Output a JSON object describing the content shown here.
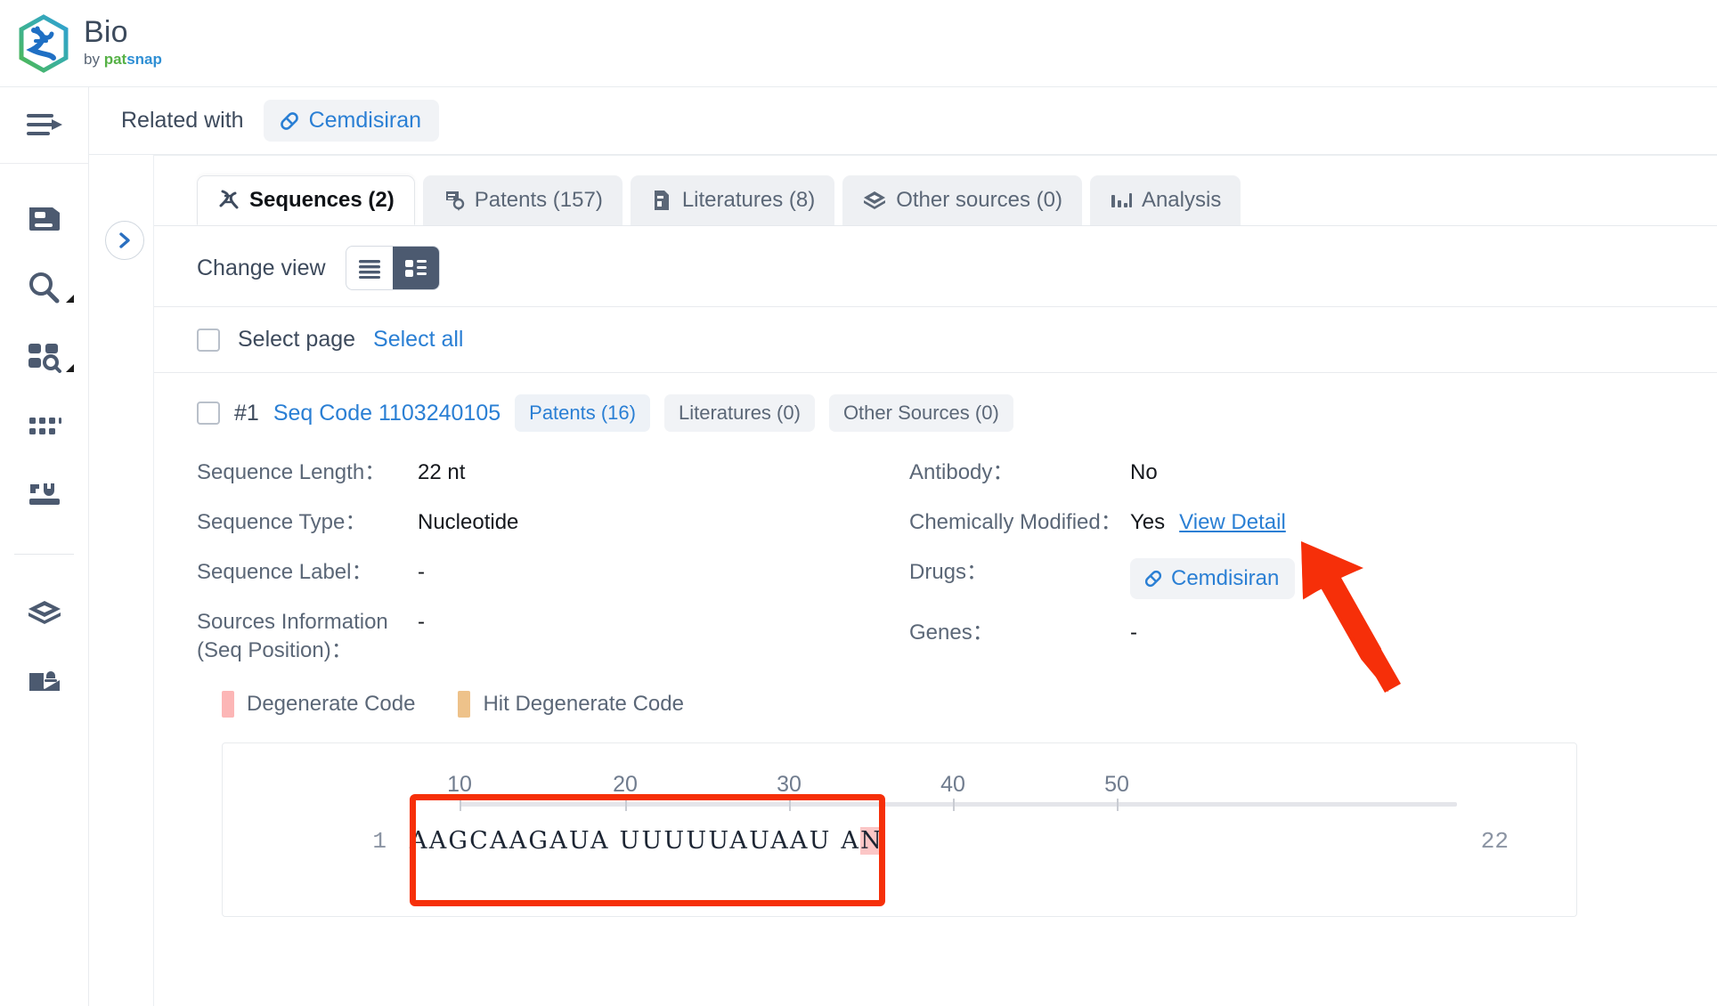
{
  "brand": {
    "title": "Bio",
    "by": "by",
    "pat": "pat",
    "snap": "snap",
    "logo_icon": "dna-hexagon-logo-icon",
    "colors": {
      "green": "#56b146",
      "blue": "#2f8fd4",
      "title": "#3c4a5c"
    }
  },
  "sidebar": {
    "toggle": {
      "name": "collapse-menu-icon"
    },
    "items": [
      {
        "name": "document-icon",
        "label": "Documents",
        "has_caret": false
      },
      {
        "name": "search-icon",
        "label": "Search",
        "has_caret": true
      },
      {
        "name": "grid-search-icon",
        "label": "Batch Search",
        "has_caret": true
      },
      {
        "name": "dots-grid-icon",
        "label": "Datasets",
        "has_caret": false
      },
      {
        "name": "tools-icon",
        "label": "Tools",
        "has_caret": false
      },
      {
        "name": "cube-icon",
        "label": "Workspace",
        "has_caret": false
      },
      {
        "name": "inbox-alert-icon",
        "label": "Inbox",
        "has_caret": false
      }
    ]
  },
  "related": {
    "label": "Related with",
    "chip": {
      "icon": "pill-capsule-icon",
      "text": "Cemdisiran"
    }
  },
  "collapse_button": {
    "icon": "chevron-right-icon"
  },
  "tabs": [
    {
      "id": "sequences",
      "label": "Sequences (2)",
      "icon": "dna-icon",
      "active": true
    },
    {
      "id": "patents",
      "label": "Patents (157)",
      "icon": "patent-doc-icon",
      "active": false
    },
    {
      "id": "literatures",
      "label": "Literatures (8)",
      "icon": "literature-doc-icon",
      "active": false
    },
    {
      "id": "other-sources",
      "label": "Other sources (0)",
      "icon": "cube-icon",
      "active": false
    },
    {
      "id": "analysis",
      "label": "Analysis",
      "icon": "bar-chart-icon",
      "active": false
    }
  ],
  "change_view": {
    "label": "Change view",
    "options": [
      {
        "id": "list",
        "icon": "list-view-icon",
        "active": false
      },
      {
        "id": "card",
        "icon": "card-view-icon",
        "active": true
      }
    ]
  },
  "selection": {
    "select_page": "Select page",
    "select_all": "Select all",
    "checked": false
  },
  "record": {
    "index": "#1",
    "code": "Seq Code 1103240105",
    "badges": [
      {
        "label": "Patents (16)",
        "accent": true
      },
      {
        "label": "Literatures (0)",
        "accent": false
      },
      {
        "label": "Other Sources (0)",
        "accent": false
      }
    ],
    "fields_left": [
      {
        "label": "Sequence Length：",
        "value": "22 nt"
      },
      {
        "label": "Sequence Type：",
        "value": "Nucleotide"
      },
      {
        "label": "Sequence Label：",
        "value": "-"
      },
      {
        "label": "Sources Information (Seq Position)：",
        "value": "-"
      }
    ],
    "fields_right": {
      "antibody": {
        "label": "Antibody：",
        "value": "No"
      },
      "chem_mod": {
        "label": "Chemically Modified：",
        "value": "Yes",
        "link": "View Detail"
      },
      "drugs": {
        "label": "Drugs：",
        "chip_icon": "pill-capsule-icon",
        "chip_text": "Cemdisiran"
      },
      "genes": {
        "label": "Genes：",
        "value": "-"
      }
    }
  },
  "legend": [
    {
      "label": "Degenerate Code",
      "color": "#fcb6b6"
    },
    {
      "label": "Hit Degenerate Code",
      "color": "#eec28a"
    }
  ],
  "sequence_viewer": {
    "ruler_ticks": [
      "10",
      "20",
      "30",
      "40",
      "50"
    ],
    "start_position": "1",
    "end_position": "22",
    "sequence_plain": "AAGCAAGAUA UUUUUAUAAU A",
    "highlight_char": "N",
    "highlight_color": "#fcc6c6"
  },
  "annotations": {
    "arrow_color": "#f62f09",
    "rect_color": "#f62f09",
    "arrow_target": "View Detail",
    "rect_target": "sequence-line"
  }
}
